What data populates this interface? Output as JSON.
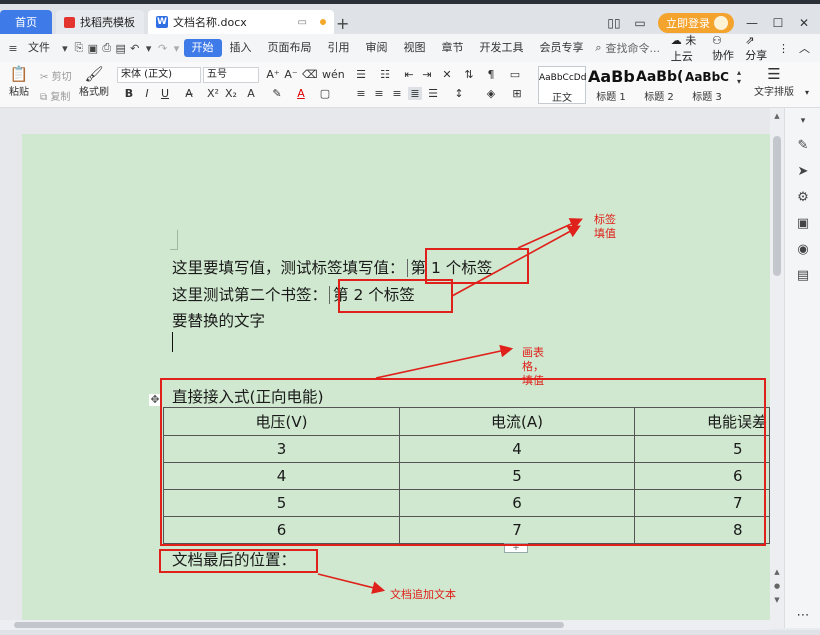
{
  "tabs": {
    "home": "首页",
    "templates": "找稻壳模板",
    "doc": "文档名称.docx",
    "new_tab": "+"
  },
  "window": {
    "login": "立即登录",
    "restore": "▭",
    "minimize": "—",
    "maximize": "☐",
    "close": "✕"
  },
  "menu": {
    "file": "文件",
    "items": [
      "开始",
      "插入",
      "页面布局",
      "引用",
      "审阅",
      "视图",
      "章节",
      "开发工具",
      "会员专享"
    ],
    "active": "开始",
    "search": "查找命令...",
    "cloud": "未上云",
    "collab": "协作",
    "share": "分享"
  },
  "ribbon": {
    "paste": "粘贴",
    "cut": "剪切",
    "copy": "复制",
    "format_painter": "格式刷",
    "font_name": "宋体 (正文)",
    "font_size": "五号",
    "styles": [
      {
        "sample": "AaBbCcDd",
        "label": "正文"
      },
      {
        "sample": "AaBb",
        "label": "标题 1"
      },
      {
        "sample": "AaBb(",
        "label": "标题 2"
      },
      {
        "sample": "AaBbC",
        "label": "标题 3"
      }
    ],
    "text_layout": "文字排版"
  },
  "document": {
    "line1_prefix": "这里要填写值，测试标签填写值：",
    "line1_value": "第 1 个标签",
    "line2_prefix": "这里测试第二个书签：",
    "line2_value": "第 2 个标签",
    "line3": "要替换的文字",
    "table_title": "直接接入式(正向电能)",
    "table_headers": [
      "电压(V)",
      "电流(A)",
      "电能误差"
    ],
    "table_rows": [
      [
        "3",
        "4",
        "5"
      ],
      [
        "4",
        "5",
        "6"
      ],
      [
        "5",
        "6",
        "7"
      ],
      [
        "6",
        "7",
        "8"
      ]
    ],
    "last_line": "文档最后的位置："
  },
  "annotations": {
    "label_fill": "标签\n填值",
    "table_fill": "画表\n格，\n填值",
    "append_text": "文档追加文本",
    "color": "#e0201a"
  }
}
